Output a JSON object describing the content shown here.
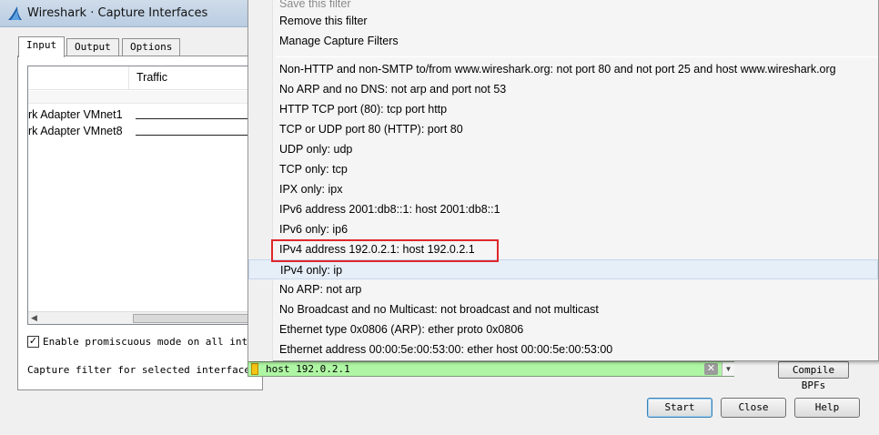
{
  "window": {
    "title": "Wireshark · Capture Interfaces"
  },
  "tabs": [
    {
      "label": "Input",
      "active": true
    },
    {
      "label": "Output",
      "active": false
    },
    {
      "label": "Options",
      "active": false
    }
  ],
  "interface_table": {
    "columns": [
      "Traffic"
    ],
    "rows": [
      {
        "name": "rk Adapter VMnet1"
      },
      {
        "name": "rk Adapter VMnet8"
      }
    ]
  },
  "promiscuous": {
    "label": "Enable promiscuous mode on all interf",
    "checked": true,
    "check_glyph": "✓"
  },
  "capture_filter": {
    "label": "Capture filter for selected interfaces:",
    "value": "host 192.0.2.1",
    "clear_glyph": "✕",
    "dropdown_glyph": "▼",
    "input_color": "#aff6a4"
  },
  "compile_button": "Compile BPFs",
  "buttons": {
    "start": "Start",
    "close": "Close",
    "help": "Help"
  },
  "filter_menu": {
    "top_items": [
      {
        "label": "Save this filter",
        "faded": true
      },
      {
        "label": "Remove this filter",
        "faded": false
      },
      {
        "label": "Manage Capture Filters",
        "faded": false
      }
    ],
    "filters": [
      "Non-HTTP and non-SMTP to/from www.wireshark.org: not port 80 and not port 25 and host www.wireshark.org",
      "No ARP and no DNS: not arp and port not 53",
      "HTTP TCP port (80): tcp port http",
      "TCP or UDP port 80 (HTTP): port 80",
      "UDP only: udp",
      "TCP only: tcp",
      "IPX only: ipx",
      "IPv6 address 2001:db8::1: host 2001:db8::1",
      "IPv6 only: ip6",
      "IPv4 address 192.0.2.1: host 192.0.2.1",
      "IPv4 only: ip",
      "No ARP: not arp",
      "No Broadcast and no Multicast: not broadcast and not multicast",
      "Ethernet type 0x0806 (ARP): ether proto 0x0806",
      "Ethernet address 00:00:5e:00:53:00: ether host 00:00:5e:00:53:00"
    ],
    "hovered_index": 10,
    "highlighted_index": 9,
    "highlight_color": "#e0272b"
  },
  "icons": {
    "app": "wireshark-fin-icon",
    "bookmark": "bookmark-icon"
  }
}
